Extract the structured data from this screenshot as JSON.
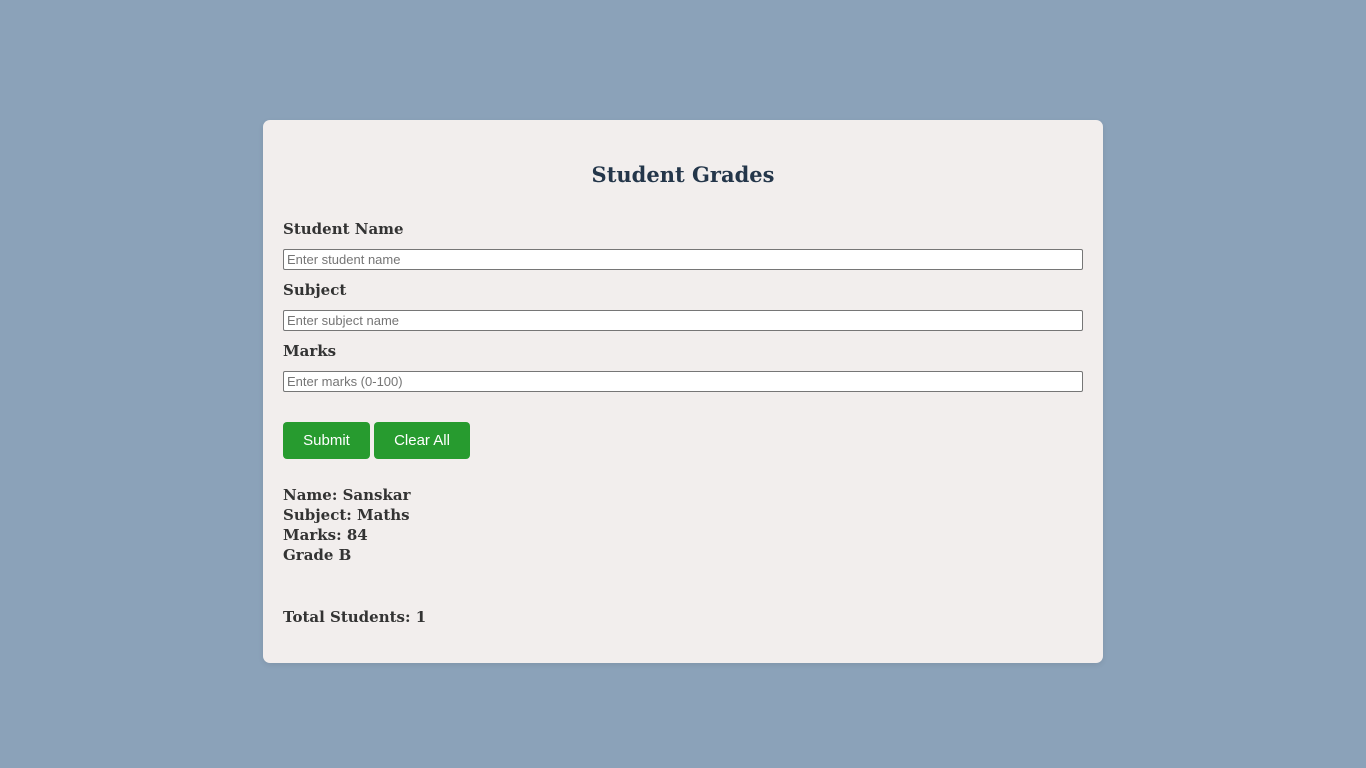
{
  "app": {
    "title": "Student Grades"
  },
  "form": {
    "name_label": "Student Name",
    "name_placeholder": "Enter student name",
    "name_value": "",
    "subject_label": "Subject",
    "subject_placeholder": "Enter subject name",
    "subject_value": "",
    "marks_label": "Marks",
    "marks_placeholder": "Enter marks (0-100)",
    "marks_value": "",
    "submit_label": "Submit",
    "clear_label": "Clear All"
  },
  "results": [
    {
      "name": "Name: Sanskar",
      "subject": "Subject: Maths",
      "marks": "Marks: 84",
      "grade": "Grade B"
    }
  ],
  "summary": {
    "total": "Total Students: 1"
  },
  "colors": {
    "background": "#8ba2b9",
    "card": "#f2eeed",
    "button": "#279b2f",
    "title": "#24364a"
  }
}
